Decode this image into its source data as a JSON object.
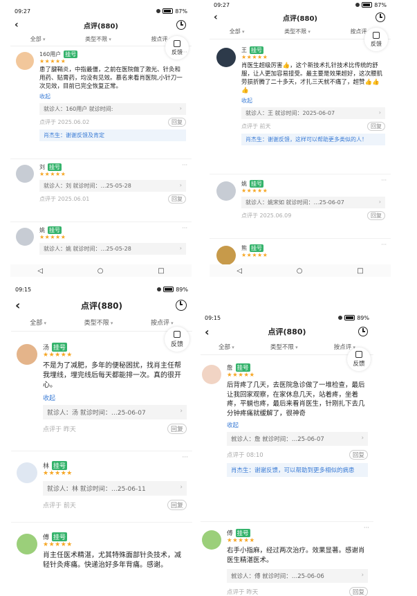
{
  "screens": [
    {
      "status_time": "09:27",
      "battery": "87%",
      "title": "点评(880)",
      "filters": [
        "全部",
        "类型不限",
        "按点评"
      ],
      "feedback_label": "反馈",
      "reviews": [
        {
          "name": "160用户",
          "badge": "挂号",
          "text": "患了腱鞘炎，中指最僵，之前在医院做了激光、针灸和用药、贴膏药，均没有见效。慕名来看肖医院,小针刀一次见效，目前已完全恢复正常。",
          "collapse": "收起",
          "visit": "就诊人：160用户    就诊时间:",
          "date": "点评于  2025.06.02",
          "reply_btn": "回复",
          "reply": "肖杰生：谢谢反馈及肯定"
        },
        {
          "name": "刘",
          "badge": "挂号",
          "visit": "就诊人：刘    就诊时间：…25-05-28",
          "date": "点评于  2025.06.01",
          "reply_btn": "回复"
        },
        {
          "name": "姚",
          "badge": "挂号",
          "visit": "就诊人：姚    就诊时间：…25-05-28"
        }
      ]
    },
    {
      "status_time": "09:27",
      "battery": "87%",
      "title": "点评(880)",
      "filters": [
        "全部",
        "类型不限",
        "按点评"
      ],
      "feedback_label": "反馈",
      "reviews": [
        {
          "name": "王",
          "badge": "挂号",
          "text": "肖医生超级厉害👍，这个新技术扎针技术比传统的舒服，让人更加容易接受。最主要是效果超好，这次腰肌劳损折腾了二十多天，才扎三天就不痛了，超赞👍👍👍",
          "collapse": "收起",
          "visit": "就诊人：王    就诊时间：2025-06-07",
          "date": "点评于  前天",
          "reply_btn": "回复",
          "reply": "肖杰生：谢谢反馈，这样可以帮助更多类似的人！"
        },
        {
          "name": "姚",
          "badge": "挂号",
          "visit": "就诊人：姚宋如    就诊时间：…25-06-07",
          "date": "点评于  2025.06.09",
          "reply_btn": "回复"
        },
        {
          "name": "熊",
          "badge": "挂号"
        }
      ]
    },
    {
      "status_time": "09:15",
      "battery": "89%",
      "title": "点评(880)",
      "filters": [
        "全部",
        "类型不限",
        "按点评"
      ],
      "feedback_label": "反馈",
      "reviews": [
        {
          "name": "汤",
          "badge": "挂号",
          "text": "不是为了减肥，多年的便秘困扰，找肖主任帮我埋线，埋完线后每天都能排一次。真的很开心。",
          "collapse": "收起",
          "visit": "就诊人：汤    就诊时间：…25-06-07",
          "date": "点评于  昨天",
          "reply_btn": "回复"
        },
        {
          "name": "林",
          "badge": "挂号",
          "visit": "就诊人：林    就诊时间：…25-06-11",
          "date": "点评于  前天",
          "reply_btn": "回复"
        },
        {
          "name": "傅",
          "badge": "挂号",
          "text": "肖主任医术精湛，尤其特殊面部针灸技术，减轻针灸疼痛。快递治好多年背痛。感谢。"
        }
      ]
    },
    {
      "status_time": "09:15",
      "battery": "89%",
      "title": "点评(880)",
      "filters": [
        "全部",
        "类型不限",
        "按点评"
      ],
      "feedback_label": "反馈",
      "reviews": [
        {
          "name": "詹",
          "badge": "挂号",
          "text": "后背疼了几天，去医院急诊做了一堆检查，最后让我回家观察，在家休息几天，站着疼，坐着疼，平躺也疼，最后来看肖医生，针刚扎下去几分钟疼痛就缓解了，很神奇",
          "collapse": "收起",
          "visit": "就诊人：詹    就诊时间：…25-06-07",
          "date": "点评于  08:10",
          "reply_btn": "回复",
          "reply": "肖杰生：谢谢反馈，可以帮助到更多相似的病患"
        },
        {
          "name": "傅",
          "badge": "挂号",
          "text": "右手小指麻，经过两次治疗。效果显著。感谢肖医生精湛医术。",
          "visit": "就诊人：傅    就诊时间：…25-06-06",
          "date": "点评于  昨天",
          "reply_btn": "回复"
        }
      ]
    }
  ],
  "stars": "★★★★★",
  "nav": [
    "◁",
    "○",
    "□"
  ],
  "colors": {
    "badge": "#34b36b",
    "star": "#f6a623",
    "link": "#3a7bd5"
  }
}
